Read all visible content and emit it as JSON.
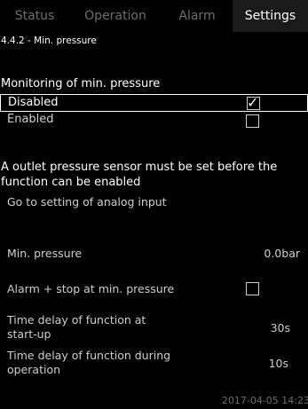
{
  "tabs": [
    {
      "label": "Status"
    },
    {
      "label": "Operation"
    },
    {
      "label": "Alarm"
    },
    {
      "label": "Settings"
    }
  ],
  "breadcrumb": "4.4.2 - Min. pressure",
  "monitoring": {
    "heading": "Monitoring of min. pressure",
    "options": [
      {
        "label": "Disabled",
        "checked": true
      },
      {
        "label": "Enabled",
        "checked": false
      }
    ]
  },
  "note": "A outlet pressure sensor must be set before the function can be enabled",
  "goto_link": "Go to setting of analog input",
  "params": {
    "min_pressure": {
      "label": "Min. pressure",
      "value": "0.0bar"
    },
    "alarm_stop": {
      "label": "Alarm + stop at min. pressure",
      "checked": false
    },
    "delay_startup": {
      "label": "Time delay of function at start-up",
      "value": "30s"
    },
    "delay_operation": {
      "label": "Time delay of function during operation",
      "value": "10s"
    }
  },
  "timestamp": "2017-04-05 14:23",
  "check_glyph": "✓"
}
